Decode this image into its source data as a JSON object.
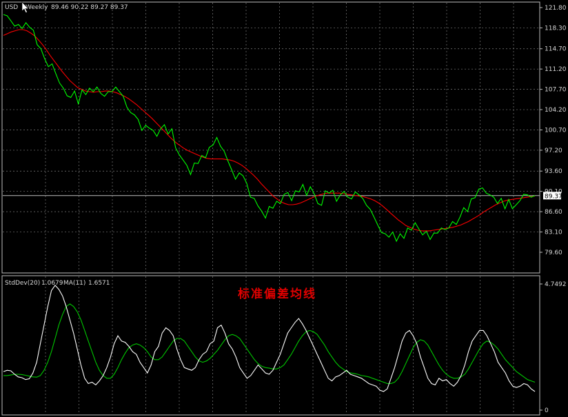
{
  "colors": {
    "background": "#000000",
    "grid": "#7f7f7f",
    "frame": "#c0c0c0",
    "price_line": "#00ff00",
    "ma_line": "#ff0000",
    "stddev_line": "#ffffff",
    "stddev_ma_line": "#00c800",
    "annotation": "#e00000",
    "current_price_box": "#ffffff"
  },
  "cursor_icon": "arrow-cursor-icon",
  "chart_data": [
    {
      "type": "line",
      "panel": "main",
      "title": "USDJPY,Weekly  89.46 90.22 89.27 89.37",
      "symbol_label": "USD",
      "timeframe_label": "Weekly",
      "ohlc_label": "89.46 90.22 89.27 89.37",
      "ylim": [
        79.6,
        121.8
      ],
      "y_ticks": [
        "121.80",
        "118.30",
        "114.70",
        "111.20",
        "107.70",
        "104.20",
        "100.70",
        "97.20",
        "93.60",
        "90.10",
        "86.60",
        "83.10",
        "79.60"
      ],
      "current_price": 89.37,
      "current_price_label": "89.37",
      "grid": true,
      "series": [
        {
          "role": "price",
          "values": [
            120.6,
            120.4,
            119.5,
            118.6,
            118.9,
            118.2,
            119.2,
            118.4,
            117.9,
            115.4,
            114.7,
            113.0,
            111.6,
            112.1,
            110.4,
            108.8,
            107.9,
            106.6,
            106.3,
            107.4,
            105.2,
            107.6,
            106.8,
            107.9,
            107.3,
            108.1,
            107.0,
            106.5,
            107.3,
            107.3,
            108.1,
            107.3,
            106.5,
            104.6,
            103.7,
            103.3,
            102.5,
            100.6,
            101.5,
            101.0,
            100.6,
            99.6,
            100.9,
            101.6,
            100.0,
            100.9,
            97.6,
            96.4,
            95.5,
            94.6,
            93.0,
            95.0,
            94.9,
            96.3,
            95.9,
            97.7,
            98.1,
            99.4,
            97.9,
            97.0,
            95.3,
            93.8,
            92.2,
            93.3,
            92.8,
            91.5,
            89.1,
            88.9,
            87.6,
            86.7,
            85.5,
            87.5,
            87.2,
            88.4,
            88.0,
            89.6,
            89.9,
            88.5,
            90.2,
            90.0,
            91.3,
            89.4,
            90.9,
            89.7,
            88.0,
            87.7,
            90.2,
            89.8,
            90.3,
            88.4,
            89.5,
            90.1,
            89.1,
            88.8,
            90.0,
            89.5,
            88.9,
            87.7,
            87.0,
            85.7,
            84.3,
            83.0,
            82.8,
            82.2,
            83.1,
            81.5,
            82.8,
            82.0,
            83.8,
            83.4,
            84.7,
            83.6,
            82.6,
            83.2,
            81.8,
            82.9,
            82.9,
            83.8,
            83.5,
            83.8,
            84.9,
            84.4,
            85.7,
            87.3,
            86.6,
            88.8,
            89.0,
            90.5,
            90.7,
            89.8,
            89.5,
            89.1,
            88.0,
            88.9,
            87.1,
            88.7,
            87.1,
            87.8,
            88.5,
            89.6,
            89.5,
            89.1,
            89.37
          ]
        },
        {
          "role": "moving-average",
          "values": [
            117.0,
            117.3,
            117.6,
            117.8,
            118.0,
            118.0,
            117.8,
            117.4,
            116.9,
            116.2,
            115.4,
            114.5,
            113.5,
            112.6,
            111.7,
            110.8,
            110.0,
            109.2,
            108.6,
            108.0,
            107.7,
            107.4,
            107.3,
            107.2,
            107.3,
            107.3,
            107.4,
            107.4,
            107.3,
            107.1,
            106.8,
            106.5,
            106.1,
            105.6,
            105.1,
            104.5,
            103.9,
            103.3,
            102.7,
            102.0,
            101.3,
            100.6,
            99.9,
            99.2,
            98.6,
            98.1,
            97.6,
            97.2,
            96.9,
            96.6,
            96.3,
            96.0,
            95.8,
            95.7,
            95.7,
            95.7,
            95.7,
            95.6,
            95.5,
            95.3,
            95.0,
            94.6,
            94.1,
            93.5,
            92.9,
            92.2,
            91.4,
            90.7,
            90.0,
            89.3,
            88.8,
            88.3,
            88.0,
            87.8,
            87.8,
            87.9,
            88.1,
            88.4,
            88.7,
            89.0,
            89.3,
            89.5,
            89.7,
            89.8,
            89.8,
            89.8,
            89.8,
            89.7,
            89.6,
            89.5,
            89.4,
            89.3,
            89.2,
            89.0,
            88.8,
            88.5,
            88.1,
            87.6,
            87.0,
            86.4,
            85.8,
            85.2,
            84.7,
            84.2,
            83.9,
            83.6,
            83.4,
            83.3,
            83.3,
            83.3,
            83.4,
            83.5,
            83.6,
            83.7,
            83.8,
            83.9,
            84.1,
            84.3,
            84.6,
            84.9,
            85.3,
            85.7,
            86.1,
            86.6,
            87.0,
            87.4,
            87.8,
            88.1,
            88.4,
            88.6,
            88.7,
            88.8,
            88.9,
            89.0,
            89.1,
            89.2,
            89.3
          ]
        }
      ]
    },
    {
      "type": "line",
      "panel": "indicator",
      "title": "StdDev(20) 1.0679  MA(11) 1.6571",
      "name_label": "StdDev(20)",
      "value_label": "1.0679",
      "ma_label": "MA(11)",
      "ma_value_label": "1.6571",
      "ylim": [
        0,
        4.7492
      ],
      "y_ticks": [
        "4.7492",
        "0"
      ],
      "grid": true,
      "annotation": "标准偏差均线",
      "series": [
        {
          "role": "stddev",
          "values": [
            1.45,
            1.5,
            1.48,
            1.35,
            1.25,
            1.22,
            1.15,
            1.18,
            1.4,
            1.8,
            2.5,
            3.2,
            3.9,
            4.5,
            4.7,
            4.55,
            4.3,
            3.9,
            3.4,
            2.9,
            2.3,
            1.7,
            1.2,
            1.0,
            1.05,
            0.95,
            1.1,
            1.3,
            1.6,
            2.0,
            2.5,
            2.8,
            2.6,
            2.55,
            2.4,
            2.2,
            2.1,
            1.8,
            1.6,
            1.4,
            1.7,
            2.2,
            2.4,
            2.9,
            3.1,
            3.0,
            2.8,
            2.3,
            1.9,
            1.6,
            1.55,
            1.5,
            1.6,
            1.9,
            2.1,
            2.2,
            2.5,
            2.6,
            3.1,
            3.2,
            2.9,
            2.5,
            2.3,
            2.0,
            1.6,
            1.4,
            1.2,
            1.3,
            1.5,
            1.7,
            1.55,
            1.4,
            1.35,
            1.5,
            1.8,
            2.1,
            2.5,
            2.9,
            3.1,
            3.3,
            3.45,
            3.25,
            3.0,
            2.7,
            2.4,
            2.1,
            1.8,
            1.5,
            1.2,
            1.1,
            1.25,
            1.3,
            1.4,
            1.5,
            1.35,
            1.3,
            1.25,
            1.2,
            1.1,
            1.0,
            0.95,
            0.9,
            0.75,
            0.7,
            0.8,
            1.2,
            1.6,
            2.1,
            2.6,
            2.9,
            3.0,
            2.8,
            2.5,
            2.0,
            1.6,
            1.2,
            1.0,
            0.95,
            1.2,
            1.1,
            1.15,
            1.0,
            0.9,
            1.05,
            1.3,
            1.7,
            2.2,
            2.6,
            2.8,
            3.0,
            3.0,
            2.8,
            2.5,
            2.2,
            1.8,
            1.6,
            1.4,
            1.1,
            0.9,
            0.85,
            0.9,
            1.0,
            0.95,
            0.8,
            0.7
          ]
        },
        {
          "role": "stddev-ma",
          "values": [
            1.3,
            1.3,
            1.32,
            1.35,
            1.35,
            1.34,
            1.31,
            1.28,
            1.25,
            1.24,
            1.3,
            1.5,
            1.8,
            2.2,
            2.7,
            3.2,
            3.6,
            3.9,
            4.0,
            3.9,
            3.7,
            3.4,
            3.0,
            2.6,
            2.2,
            1.8,
            1.5,
            1.3,
            1.2,
            1.2,
            1.35,
            1.6,
            1.9,
            2.15,
            2.35,
            2.45,
            2.5,
            2.45,
            2.35,
            2.2,
            2.0,
            1.9,
            1.9,
            2.0,
            2.2,
            2.4,
            2.6,
            2.7,
            2.7,
            2.6,
            2.4,
            2.2,
            2.0,
            1.85,
            1.8,
            1.85,
            1.95,
            2.1,
            2.25,
            2.45,
            2.65,
            2.8,
            2.85,
            2.8,
            2.7,
            2.5,
            2.3,
            2.1,
            1.9,
            1.75,
            1.65,
            1.6,
            1.58,
            1.55,
            1.55,
            1.6,
            1.7,
            1.9,
            2.1,
            2.35,
            2.6,
            2.8,
            2.95,
            3.0,
            2.95,
            2.85,
            2.65,
            2.45,
            2.2,
            2.0,
            1.8,
            1.65,
            1.55,
            1.45,
            1.4,
            1.38,
            1.35,
            1.3,
            1.28,
            1.25,
            1.2,
            1.15,
            1.1,
            1.05,
            1.0,
            1.0,
            1.05,
            1.2,
            1.45,
            1.75,
            2.05,
            2.35,
            2.55,
            2.65,
            2.6,
            2.45,
            2.2,
            1.95,
            1.7,
            1.5,
            1.35,
            1.25,
            1.2,
            1.2,
            1.25,
            1.35,
            1.55,
            1.8,
            2.05,
            2.3,
            2.5,
            2.6,
            2.55,
            2.45,
            2.3,
            2.1,
            1.9,
            1.75,
            1.6,
            1.45,
            1.35,
            1.25,
            1.15,
            1.1,
            1.05
          ]
        }
      ]
    }
  ]
}
